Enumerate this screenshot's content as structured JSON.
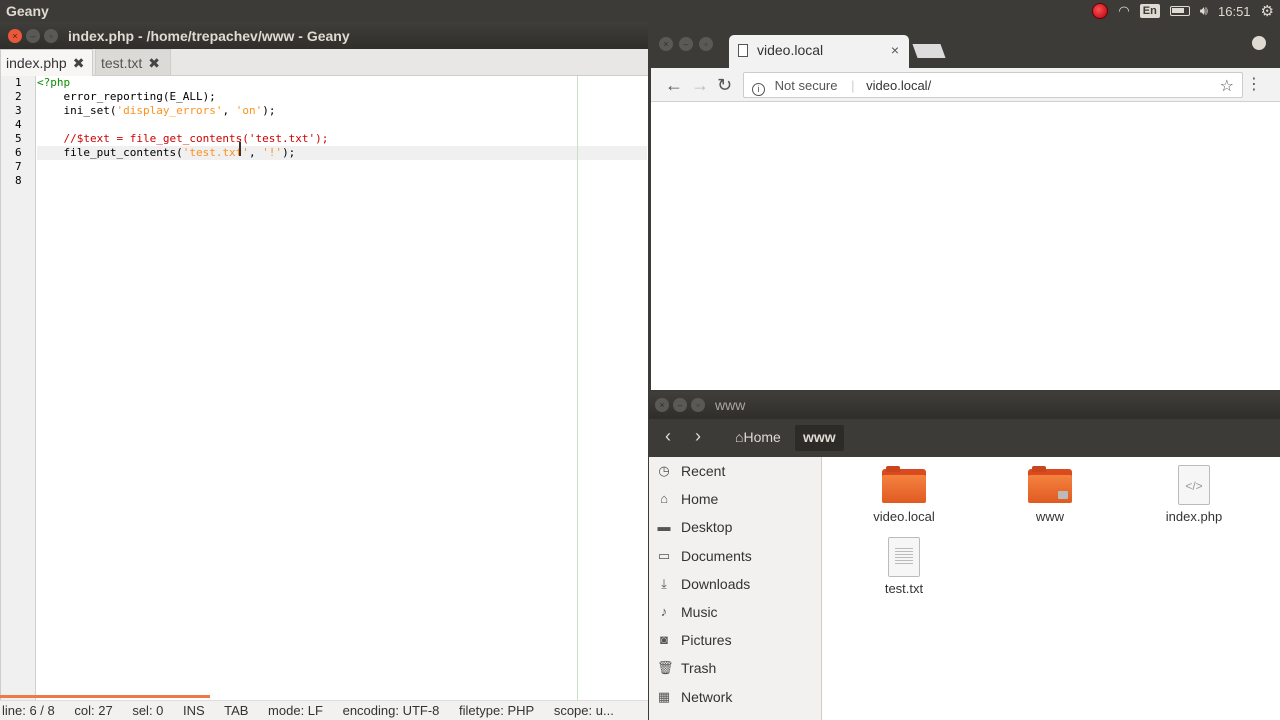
{
  "panel": {
    "app_name": "Geany",
    "lang": "En",
    "clock": "16:51"
  },
  "geany": {
    "title": "index.php - /home/trepachev/www - Geany",
    "tabs": [
      {
        "label": "index.php",
        "close": "✖"
      },
      {
        "label": "test.txt",
        "close": "✖"
      }
    ],
    "line_numbers": [
      "1",
      "2",
      "3",
      "4",
      "5",
      "6",
      "7",
      "8"
    ],
    "status": {
      "line": "line: 6 / 8",
      "col": "col: 27",
      "sel": "sel: 0",
      "ins": "INS",
      "tab": "TAB",
      "mode": "mode: LF",
      "encoding": "encoding: UTF-8",
      "filetype": "filetype: PHP",
      "scope": "scope: u..."
    }
  },
  "browser": {
    "tab_title": "video.local",
    "tab_close": "×",
    "security": "Not secure",
    "url": "video.local/"
  },
  "files": {
    "title": "www",
    "crumbs": {
      "home": "Home",
      "www": "www"
    },
    "sidebar": [
      "Recent",
      "Home",
      "Desktop",
      "Documents",
      "Downloads",
      "Music",
      "Pictures",
      "Trash",
      "Network"
    ],
    "items": [
      "video.local",
      "www",
      "index.php",
      "test.txt"
    ]
  },
  "colors": {
    "accent": "#e9583a",
    "folder": "#f4823e",
    "panel": "#3c3b37"
  }
}
